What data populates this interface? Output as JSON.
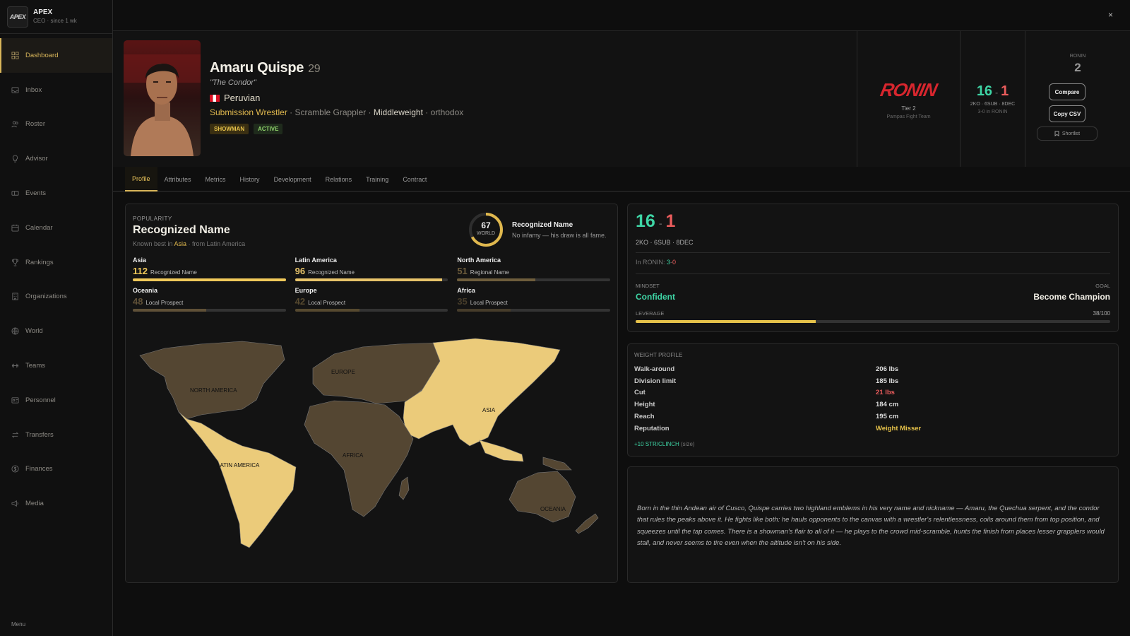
{
  "brand": {
    "logo_text": "APEX",
    "title": "APEX",
    "subtitle": "CEO · since 1 wk"
  },
  "nav": [
    {
      "label": "Dashboard",
      "icon": "grid-icon"
    },
    {
      "label": "Inbox",
      "icon": "inbox-icon"
    },
    {
      "label": "Roster",
      "icon": "users-icon"
    },
    {
      "label": "Advisor",
      "icon": "lightbulb-icon"
    },
    {
      "label": "Events",
      "icon": "ticket-icon"
    },
    {
      "label": "Calendar",
      "icon": "calendar-icon"
    },
    {
      "label": "Rankings",
      "icon": "trophy-icon"
    },
    {
      "label": "Organizations",
      "icon": "building-icon"
    },
    {
      "label": "World",
      "icon": "globe-icon"
    },
    {
      "label": "Teams",
      "icon": "dumbbell-icon"
    },
    {
      "label": "Personnel",
      "icon": "id-card-icon"
    },
    {
      "label": "Transfers",
      "icon": "transfer-icon"
    },
    {
      "label": "Finances",
      "icon": "dollar-icon"
    },
    {
      "label": "Media",
      "icon": "megaphone-icon"
    }
  ],
  "menu_label": "Menu",
  "close_label": "×",
  "fighter": {
    "name": "Amaru Quispe",
    "age": "29",
    "nickname": "\"The Condor\"",
    "nationality": "Peruvian",
    "primary_style": "Submission Wrestler",
    "secondary_style": " · Scramble Grappler · ",
    "weight_class": "Middleweight",
    "stance": " · orthodox",
    "badges": [
      "SHOWMAN",
      "ACTIVE"
    ]
  },
  "org": {
    "logo": "RONIN",
    "tier": "Tier 2",
    "team": "Pampas Fight Team"
  },
  "record": {
    "wins": "16",
    "sep": "-",
    "losses": "1",
    "breakdown": "2KO · 6SUB · 8DEC",
    "org_record": "3-0 in RONIN"
  },
  "actions": {
    "org_label": "RONIN",
    "rank": "2",
    "compare": "Compare",
    "copy_csv": "Copy CSV",
    "shortlist": "Shortlist"
  },
  "tabs": [
    "Profile",
    "Attributes",
    "Metrics",
    "History",
    "Development",
    "Relations",
    "Training",
    "Contract"
  ],
  "popularity": {
    "label": "POPULARITY",
    "title": "Recognized Name",
    "known_prefix": "Known best in ",
    "known_region": "Asia",
    "known_suffix": " · from Latin America",
    "world_score": 67,
    "world_label": "WORLD",
    "status_title": "Recognized Name",
    "status_sub": "No infamy — his draw is all fame.",
    "regions": [
      {
        "name": "Asia",
        "value": 112,
        "tier": "Recognized Name",
        "fill": 1.0,
        "color": "#f0c95a"
      },
      {
        "name": "Latin America",
        "value": 96,
        "tier": "Recognized Name",
        "fill": 0.96,
        "color": "#e8c46a"
      },
      {
        "name": "North America",
        "value": 51,
        "tier": "Regional Name",
        "fill": 0.51,
        "color": "#6e5d3c"
      },
      {
        "name": "Oceania",
        "value": 48,
        "tier": "Local Prospect",
        "fill": 0.48,
        "color": "#5f5037"
      },
      {
        "name": "Europe",
        "value": 42,
        "tier": "Local Prospect",
        "fill": 0.42,
        "color": "#56492f"
      },
      {
        "name": "Africa",
        "value": 35,
        "tier": "Local Prospect",
        "fill": 0.35,
        "color": "#463c2a"
      }
    ],
    "map_labels": [
      "NORTH AMERICA",
      "EUROPE",
      "ASIA",
      "LATIN AMERICA",
      "AFRICA",
      "OCEANIA"
    ]
  },
  "stats": {
    "wins": "16",
    "sep": "-",
    "losses": "1",
    "breakdown": "2KO · 6SUB · 8DEC",
    "org_prefix": "In RONIN: ",
    "org_wins": "3",
    "org_sep": "-",
    "org_losses": "0",
    "mindset_label": "MINDSET",
    "mindset": "Confident",
    "goal_label": "GOAL",
    "goal": "Become Champion",
    "leverage_label": "LEVERAGE",
    "leverage_text": "38/100",
    "leverage": 38
  },
  "weight": {
    "title": "WEIGHT PROFILE",
    "rows": [
      {
        "k": "Walk-around",
        "v": "206 lbs",
        "color": "#dddddd"
      },
      {
        "k": "Division limit",
        "v": "185 lbs",
        "color": "#dddddd"
      },
      {
        "k": "Cut",
        "v": "21 lbs",
        "color": "#ea5c5c"
      },
      {
        "k": "Height",
        "v": "184 cm",
        "color": "#dddddd"
      },
      {
        "k": "Reach",
        "v": "195 cm",
        "color": "#dddddd"
      },
      {
        "k": "Reputation",
        "v": "Weight Misser",
        "color": "#e6c24a"
      }
    ],
    "bonus": "+10 STR/CLINCH",
    "bonus_note": " (size)"
  },
  "bio": "Born in the thin Andean air of Cusco, Quispe carries two highland emblems in his very name and nickname — Amaru, the Quechua serpent, and the condor that rules the peaks above it. He fights like both: he hauls opponents to the canvas with a wrestler's relentlessness, coils around them from top position, and squeezes until the tap comes. There is a showman's flair to all of it — he plays to the crowd mid-scramble, hunts the finish from places lesser grapplers would stall, and never seems to tire even when the altitude isn't on his side.",
  "colors": {
    "accent": "#d9b65a",
    "win": "#3ed5a5",
    "loss": "#ea5c5c",
    "org_brand": "#d7262e",
    "map_high": "#ebcb7a",
    "map_low": "#544632"
  }
}
